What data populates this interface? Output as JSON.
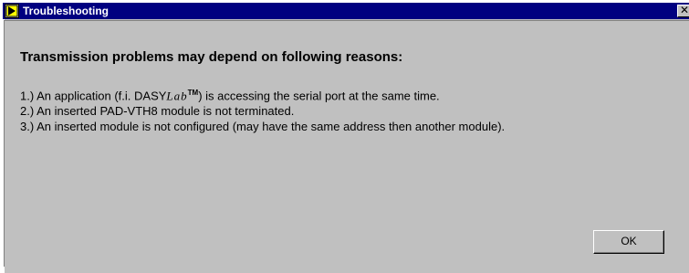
{
  "window": {
    "title": "Troubleshooting",
    "close_glyph": "✕",
    "colors": {
      "titlebar": "#000080",
      "face": "#c0c0c0",
      "title_text": "#ffffff"
    }
  },
  "dialog": {
    "heading": "Transmission problems may depend on following reasons:",
    "reasons": [
      {
        "prefix": "1.) An application (f.i. DASY",
        "italic": "Lab",
        "trademark": "TM",
        "suffix": ") is accessing the serial port at the same time."
      },
      {
        "text": "2.) An inserted PAD-VTH8 module is not terminated."
      },
      {
        "text": "3.) An inserted module is not configured (may have the same address then another module)."
      }
    ],
    "ok_label": "OK"
  }
}
